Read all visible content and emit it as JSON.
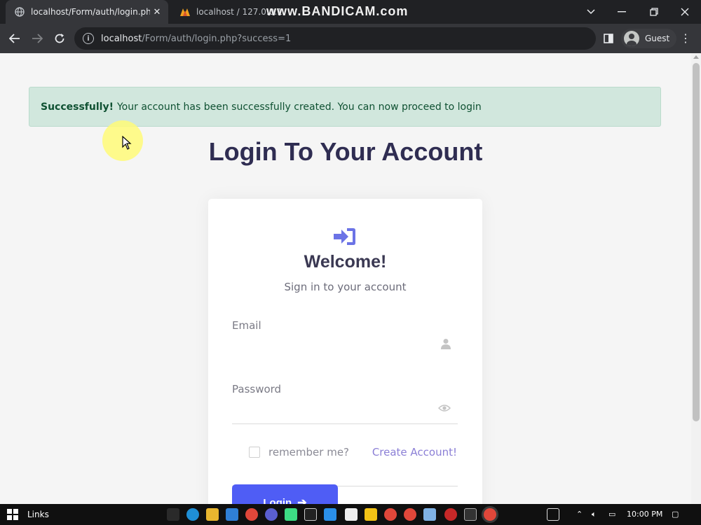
{
  "browser": {
    "tabs": [
      {
        "title": "localhost/Form/auth/login.php?s",
        "active": true,
        "favicon": "globe-icon"
      },
      {
        "title": "localhost / 127.0.0.1",
        "active": false,
        "favicon": "phpmyadmin-icon"
      }
    ],
    "watermark": "www.BANDICAM.com",
    "url_host": "localhost",
    "url_path": "/Form/auth/login.php?success=1",
    "profile_label": "Guest"
  },
  "alert": {
    "strong": "Successfully!",
    "message": "Your account has been successfully created. You can now proceed to login",
    "color": "#d1e7dd"
  },
  "page": {
    "title": "Login To Your Account"
  },
  "card": {
    "welcome": "Welcome!",
    "subtitle": "Sign in to your account",
    "email_label": "Email",
    "email_value": "",
    "password_label": "Password",
    "password_value": "",
    "remember_label": "remember me?",
    "create_account": "Create Account!",
    "login_label": "Login",
    "accent_color": "#4f5df5"
  },
  "taskbar": {
    "links_label": "Links",
    "time": "10:00 PM"
  }
}
